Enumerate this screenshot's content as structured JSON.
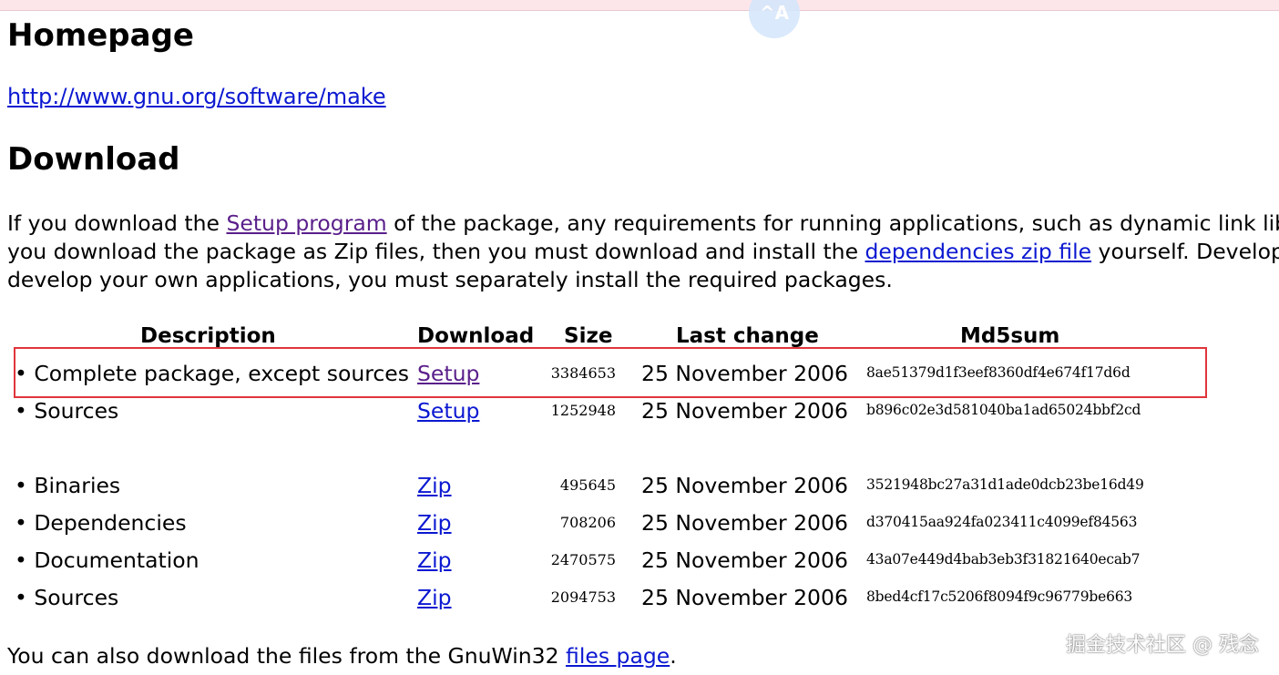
{
  "floating_button": "^A",
  "homepage": {
    "heading": "Homepage",
    "link": "http://www.gnu.org/software/make"
  },
  "download": {
    "heading": "Download",
    "para": {
      "l1_pre": "If you download the ",
      "l1_link": "Setup program",
      "l1_post": " of the package, any requirements for running applications, such as dynamic link librar",
      "l2_pre": "you download the package as Zip files, then you must download and install the ",
      "l2_link": "dependencies zip file",
      "l2_post": " yourself. Developer f",
      "l3": "develop your own applications, you must separately install the required packages."
    },
    "table": {
      "headers": [
        "Description",
        "Download",
        "Size",
        "Last change",
        "Md5sum"
      ],
      "rows": [
        {
          "desc": "• Complete package, except sources",
          "link": "Setup",
          "size": "3384653",
          "date": "25 November 2006",
          "md5": "8ae51379d1f3eef8360df4e674f17d6d"
        },
        {
          "desc": "• Sources",
          "link": "Setup",
          "size": "1252948",
          "date": "25 November 2006",
          "md5": "b896c02e3d581040ba1ad65024bbf2cd"
        },
        {
          "desc": "• Binaries",
          "link": "Zip",
          "size": "495645",
          "date": "25 November 2006",
          "md5": "3521948bc27a31d1ade0dcb23be16d49"
        },
        {
          "desc": "• Dependencies",
          "link": "Zip",
          "size": "708206",
          "date": "25 November 2006",
          "md5": "d370415aa924fa023411c4099ef84563"
        },
        {
          "desc": "• Documentation",
          "link": "Zip",
          "size": "2470575",
          "date": "25 November 2006",
          "md5": "43a07e449d4bab3eb3f31821640ecab7"
        },
        {
          "desc": "• Sources",
          "link": "Zip",
          "size": "2094753",
          "date": "25 November 2006",
          "md5": "8bed4cf17c5206f8094f9c96779be663"
        }
      ]
    },
    "footer_pre": "You can also download the files from the GnuWin32 ",
    "footer_link": "files page",
    "footer_post": "."
  },
  "watermark": "掘金技术社区 @ 残念",
  "colors": {
    "link": "#0b18d1",
    "visited_link": "#5a1f8a",
    "highlight_box": "#e0353b"
  }
}
